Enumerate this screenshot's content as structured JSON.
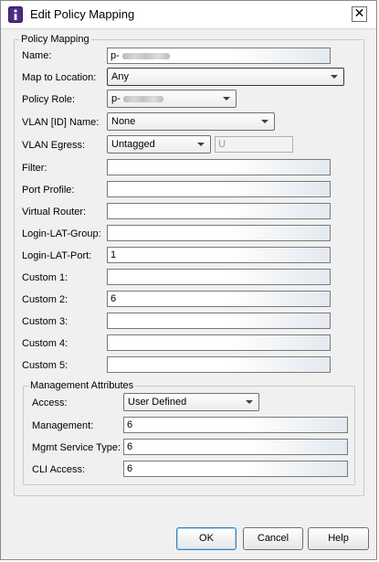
{
  "window": {
    "title": "Edit Policy Mapping",
    "close_symbol": "✕"
  },
  "policy_mapping": {
    "legend": "Policy Mapping",
    "name": {
      "label": "Name:",
      "value": "p-"
    },
    "map_to_location": {
      "label": "Map to Location:",
      "value": "Any"
    },
    "policy_role": {
      "label": "Policy Role:",
      "value": "p-"
    },
    "vlan_id_name": {
      "label": "VLAN [ID] Name:",
      "value": "None"
    },
    "vlan_egress": {
      "label": "VLAN Egress:",
      "value": "Untagged",
      "extra_value": "U"
    },
    "filter": {
      "label": "Filter:",
      "value": ""
    },
    "port_profile": {
      "label": "Port Profile:",
      "value": ""
    },
    "virtual_router": {
      "label": "Virtual Router:",
      "value": ""
    },
    "login_lat_group": {
      "label": "Login-LAT-Group:",
      "value": ""
    },
    "login_lat_port": {
      "label": "Login-LAT-Port:",
      "value": "1"
    },
    "custom1": {
      "label": "Custom 1:",
      "value": ""
    },
    "custom2": {
      "label": "Custom 2:",
      "value": "6"
    },
    "custom3": {
      "label": "Custom 3:",
      "value": ""
    },
    "custom4": {
      "label": "Custom 4:",
      "value": ""
    },
    "custom5": {
      "label": "Custom 5:",
      "value": ""
    }
  },
  "management_attributes": {
    "legend": "Management Attributes",
    "access": {
      "label": "Access:",
      "value": "User Defined"
    },
    "management": {
      "label": "Management:",
      "value": "6"
    },
    "mgmt_service_type": {
      "label": "Mgmt Service Type:",
      "value": "6"
    },
    "cli_access": {
      "label": "CLI Access:",
      "value": "6"
    }
  },
  "buttons": {
    "ok": "OK",
    "cancel": "Cancel",
    "help": "Help"
  },
  "icons": {
    "app": "app-icon",
    "close": "close-icon",
    "dropdown": "chevron-down-icon"
  },
  "colors": {
    "accent": "#3c7fb1",
    "dialog_bg": "#f0f0f0",
    "icon_purple": "#4b2e83"
  }
}
